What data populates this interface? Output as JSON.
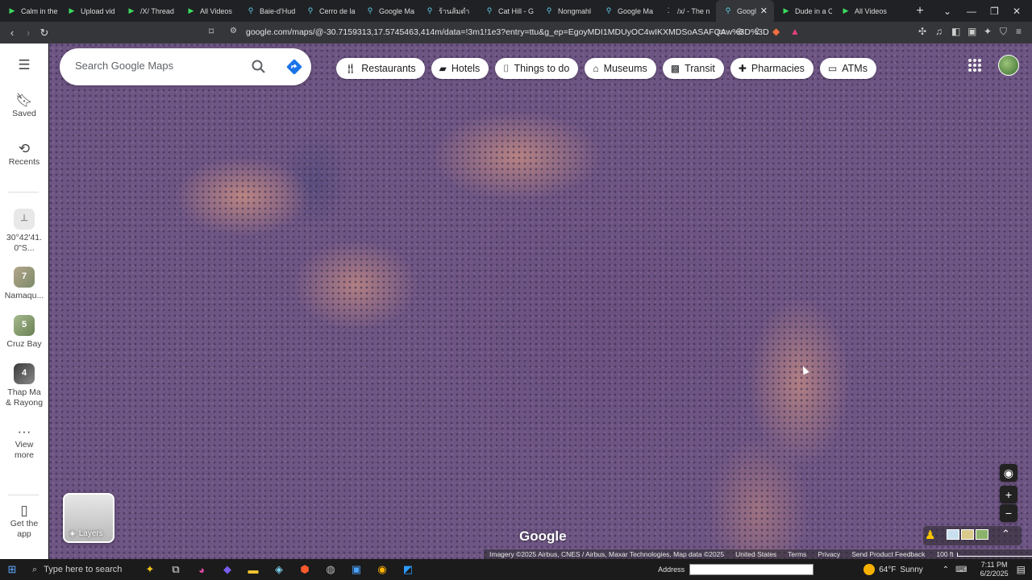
{
  "browser": {
    "tabs": [
      {
        "title": "Calm in the",
        "icon": "youtube-icon"
      },
      {
        "title": "Upload vid",
        "icon": "youtube-icon"
      },
      {
        "title": "/X/ Thread",
        "icon": "youtube-icon"
      },
      {
        "title": "All Videos",
        "icon": "youtube-icon"
      },
      {
        "title": "Baie-d'Hud",
        "icon": "maps-pin-icon"
      },
      {
        "title": "Cerro de la",
        "icon": "maps-pin-icon"
      },
      {
        "title": "Google Ma",
        "icon": "maps-pin-icon"
      },
      {
        "title": "ร้านส้มตำ",
        "icon": "maps-pin-icon"
      },
      {
        "title": "Cat Hill - G",
        "icon": "maps-pin-icon"
      },
      {
        "title": "Nongmahl",
        "icon": "maps-pin-icon"
      },
      {
        "title": "Google Ma",
        "icon": "maps-pin-icon"
      },
      {
        "title": "/x/ - The n",
        "icon": "dots-icon"
      },
      {
        "title": "Googl",
        "icon": "maps-pin-icon",
        "active": true
      },
      {
        "title": "Dude in a C",
        "icon": "youtube-icon"
      },
      {
        "title": "All Videos",
        "icon": "youtube-icon"
      }
    ],
    "url": "google.com/maps/@-30.7159313,17.5745463,414m/data=!3m1!1e3?entry=ttu&g_ep=EgoyMDI1MDUyOC4wIKXMDSoASAFQAw%3D%3D"
  },
  "maps": {
    "search_placeholder": "Search Google Maps",
    "chips": [
      {
        "label": "Restaurants",
        "icon": "fork-knife-icon"
      },
      {
        "label": "Hotels",
        "icon": "bed-icon"
      },
      {
        "label": "Things to do",
        "icon": "camera-icon"
      },
      {
        "label": "Museums",
        "icon": "museum-icon"
      },
      {
        "label": "Transit",
        "icon": "train-icon"
      },
      {
        "label": "Pharmacies",
        "icon": "pharmacy-icon"
      },
      {
        "label": "ATMs",
        "icon": "atm-icon"
      }
    ],
    "sidebar": {
      "saved": "Saved",
      "recents": "Recents",
      "recent_items": [
        {
          "label": "30°42'41.\n0\"S...",
          "thumb": ""
        },
        {
          "label": "Namaqu...",
          "thumb": "7"
        },
        {
          "label": "Cruz Bay",
          "thumb": "5"
        },
        {
          "label": "Thap Ma\n& Rayong",
          "thumb": "4"
        }
      ],
      "view_more": "View\nmore",
      "get_app": "Get the\napp"
    },
    "layers_label": "Layers",
    "google_logo": "Google",
    "attribution": {
      "imagery": "Imagery ©2025 Airbus, CNES / Airbus, Maxar Technologies, Map data ©2025",
      "country": "United States",
      "terms": "Terms",
      "privacy": "Privacy",
      "feedback": "Send Product Feedback",
      "scale": "100 ft"
    }
  },
  "taskbar": {
    "search_placeholder": "Type here to search",
    "address_label": "Address",
    "weather_temp": "64°F",
    "weather_desc": "Sunny",
    "time": "7:11 PM",
    "date": "6/2/2025"
  }
}
